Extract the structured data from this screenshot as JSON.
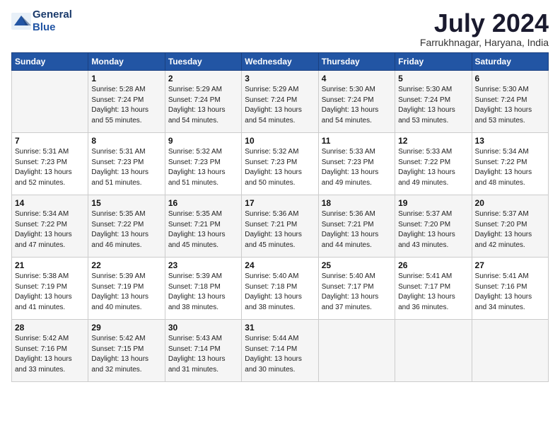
{
  "header": {
    "logo_line1": "General",
    "logo_line2": "Blue",
    "title": "July 2024",
    "location": "Farrukhnagar, Haryana, India"
  },
  "weekdays": [
    "Sunday",
    "Monday",
    "Tuesday",
    "Wednesday",
    "Thursday",
    "Friday",
    "Saturday"
  ],
  "weeks": [
    [
      {
        "day": "",
        "info": ""
      },
      {
        "day": "1",
        "info": "Sunrise: 5:28 AM\nSunset: 7:24 PM\nDaylight: 13 hours\nand 55 minutes."
      },
      {
        "day": "2",
        "info": "Sunrise: 5:29 AM\nSunset: 7:24 PM\nDaylight: 13 hours\nand 54 minutes."
      },
      {
        "day": "3",
        "info": "Sunrise: 5:29 AM\nSunset: 7:24 PM\nDaylight: 13 hours\nand 54 minutes."
      },
      {
        "day": "4",
        "info": "Sunrise: 5:30 AM\nSunset: 7:24 PM\nDaylight: 13 hours\nand 54 minutes."
      },
      {
        "day": "5",
        "info": "Sunrise: 5:30 AM\nSunset: 7:24 PM\nDaylight: 13 hours\nand 53 minutes."
      },
      {
        "day": "6",
        "info": "Sunrise: 5:30 AM\nSunset: 7:24 PM\nDaylight: 13 hours\nand 53 minutes."
      }
    ],
    [
      {
        "day": "7",
        "info": "Sunrise: 5:31 AM\nSunset: 7:23 PM\nDaylight: 13 hours\nand 52 minutes."
      },
      {
        "day": "8",
        "info": "Sunrise: 5:31 AM\nSunset: 7:23 PM\nDaylight: 13 hours\nand 51 minutes."
      },
      {
        "day": "9",
        "info": "Sunrise: 5:32 AM\nSunset: 7:23 PM\nDaylight: 13 hours\nand 51 minutes."
      },
      {
        "day": "10",
        "info": "Sunrise: 5:32 AM\nSunset: 7:23 PM\nDaylight: 13 hours\nand 50 minutes."
      },
      {
        "day": "11",
        "info": "Sunrise: 5:33 AM\nSunset: 7:23 PM\nDaylight: 13 hours\nand 49 minutes."
      },
      {
        "day": "12",
        "info": "Sunrise: 5:33 AM\nSunset: 7:22 PM\nDaylight: 13 hours\nand 49 minutes."
      },
      {
        "day": "13",
        "info": "Sunrise: 5:34 AM\nSunset: 7:22 PM\nDaylight: 13 hours\nand 48 minutes."
      }
    ],
    [
      {
        "day": "14",
        "info": "Sunrise: 5:34 AM\nSunset: 7:22 PM\nDaylight: 13 hours\nand 47 minutes."
      },
      {
        "day": "15",
        "info": "Sunrise: 5:35 AM\nSunset: 7:22 PM\nDaylight: 13 hours\nand 46 minutes."
      },
      {
        "day": "16",
        "info": "Sunrise: 5:35 AM\nSunset: 7:21 PM\nDaylight: 13 hours\nand 45 minutes."
      },
      {
        "day": "17",
        "info": "Sunrise: 5:36 AM\nSunset: 7:21 PM\nDaylight: 13 hours\nand 45 minutes."
      },
      {
        "day": "18",
        "info": "Sunrise: 5:36 AM\nSunset: 7:21 PM\nDaylight: 13 hours\nand 44 minutes."
      },
      {
        "day": "19",
        "info": "Sunrise: 5:37 AM\nSunset: 7:20 PM\nDaylight: 13 hours\nand 43 minutes."
      },
      {
        "day": "20",
        "info": "Sunrise: 5:37 AM\nSunset: 7:20 PM\nDaylight: 13 hours\nand 42 minutes."
      }
    ],
    [
      {
        "day": "21",
        "info": "Sunrise: 5:38 AM\nSunset: 7:19 PM\nDaylight: 13 hours\nand 41 minutes."
      },
      {
        "day": "22",
        "info": "Sunrise: 5:39 AM\nSunset: 7:19 PM\nDaylight: 13 hours\nand 40 minutes."
      },
      {
        "day": "23",
        "info": "Sunrise: 5:39 AM\nSunset: 7:18 PM\nDaylight: 13 hours\nand 38 minutes."
      },
      {
        "day": "24",
        "info": "Sunrise: 5:40 AM\nSunset: 7:18 PM\nDaylight: 13 hours\nand 38 minutes."
      },
      {
        "day": "25",
        "info": "Sunrise: 5:40 AM\nSunset: 7:17 PM\nDaylight: 13 hours\nand 37 minutes."
      },
      {
        "day": "26",
        "info": "Sunrise: 5:41 AM\nSunset: 7:17 PM\nDaylight: 13 hours\nand 36 minutes."
      },
      {
        "day": "27",
        "info": "Sunrise: 5:41 AM\nSunset: 7:16 PM\nDaylight: 13 hours\nand 34 minutes."
      }
    ],
    [
      {
        "day": "28",
        "info": "Sunrise: 5:42 AM\nSunset: 7:16 PM\nDaylight: 13 hours\nand 33 minutes."
      },
      {
        "day": "29",
        "info": "Sunrise: 5:42 AM\nSunset: 7:15 PM\nDaylight: 13 hours\nand 32 minutes."
      },
      {
        "day": "30",
        "info": "Sunrise: 5:43 AM\nSunset: 7:14 PM\nDaylight: 13 hours\nand 31 minutes."
      },
      {
        "day": "31",
        "info": "Sunrise: 5:44 AM\nSunset: 7:14 PM\nDaylight: 13 hours\nand 30 minutes."
      },
      {
        "day": "",
        "info": ""
      },
      {
        "day": "",
        "info": ""
      },
      {
        "day": "",
        "info": ""
      }
    ]
  ]
}
